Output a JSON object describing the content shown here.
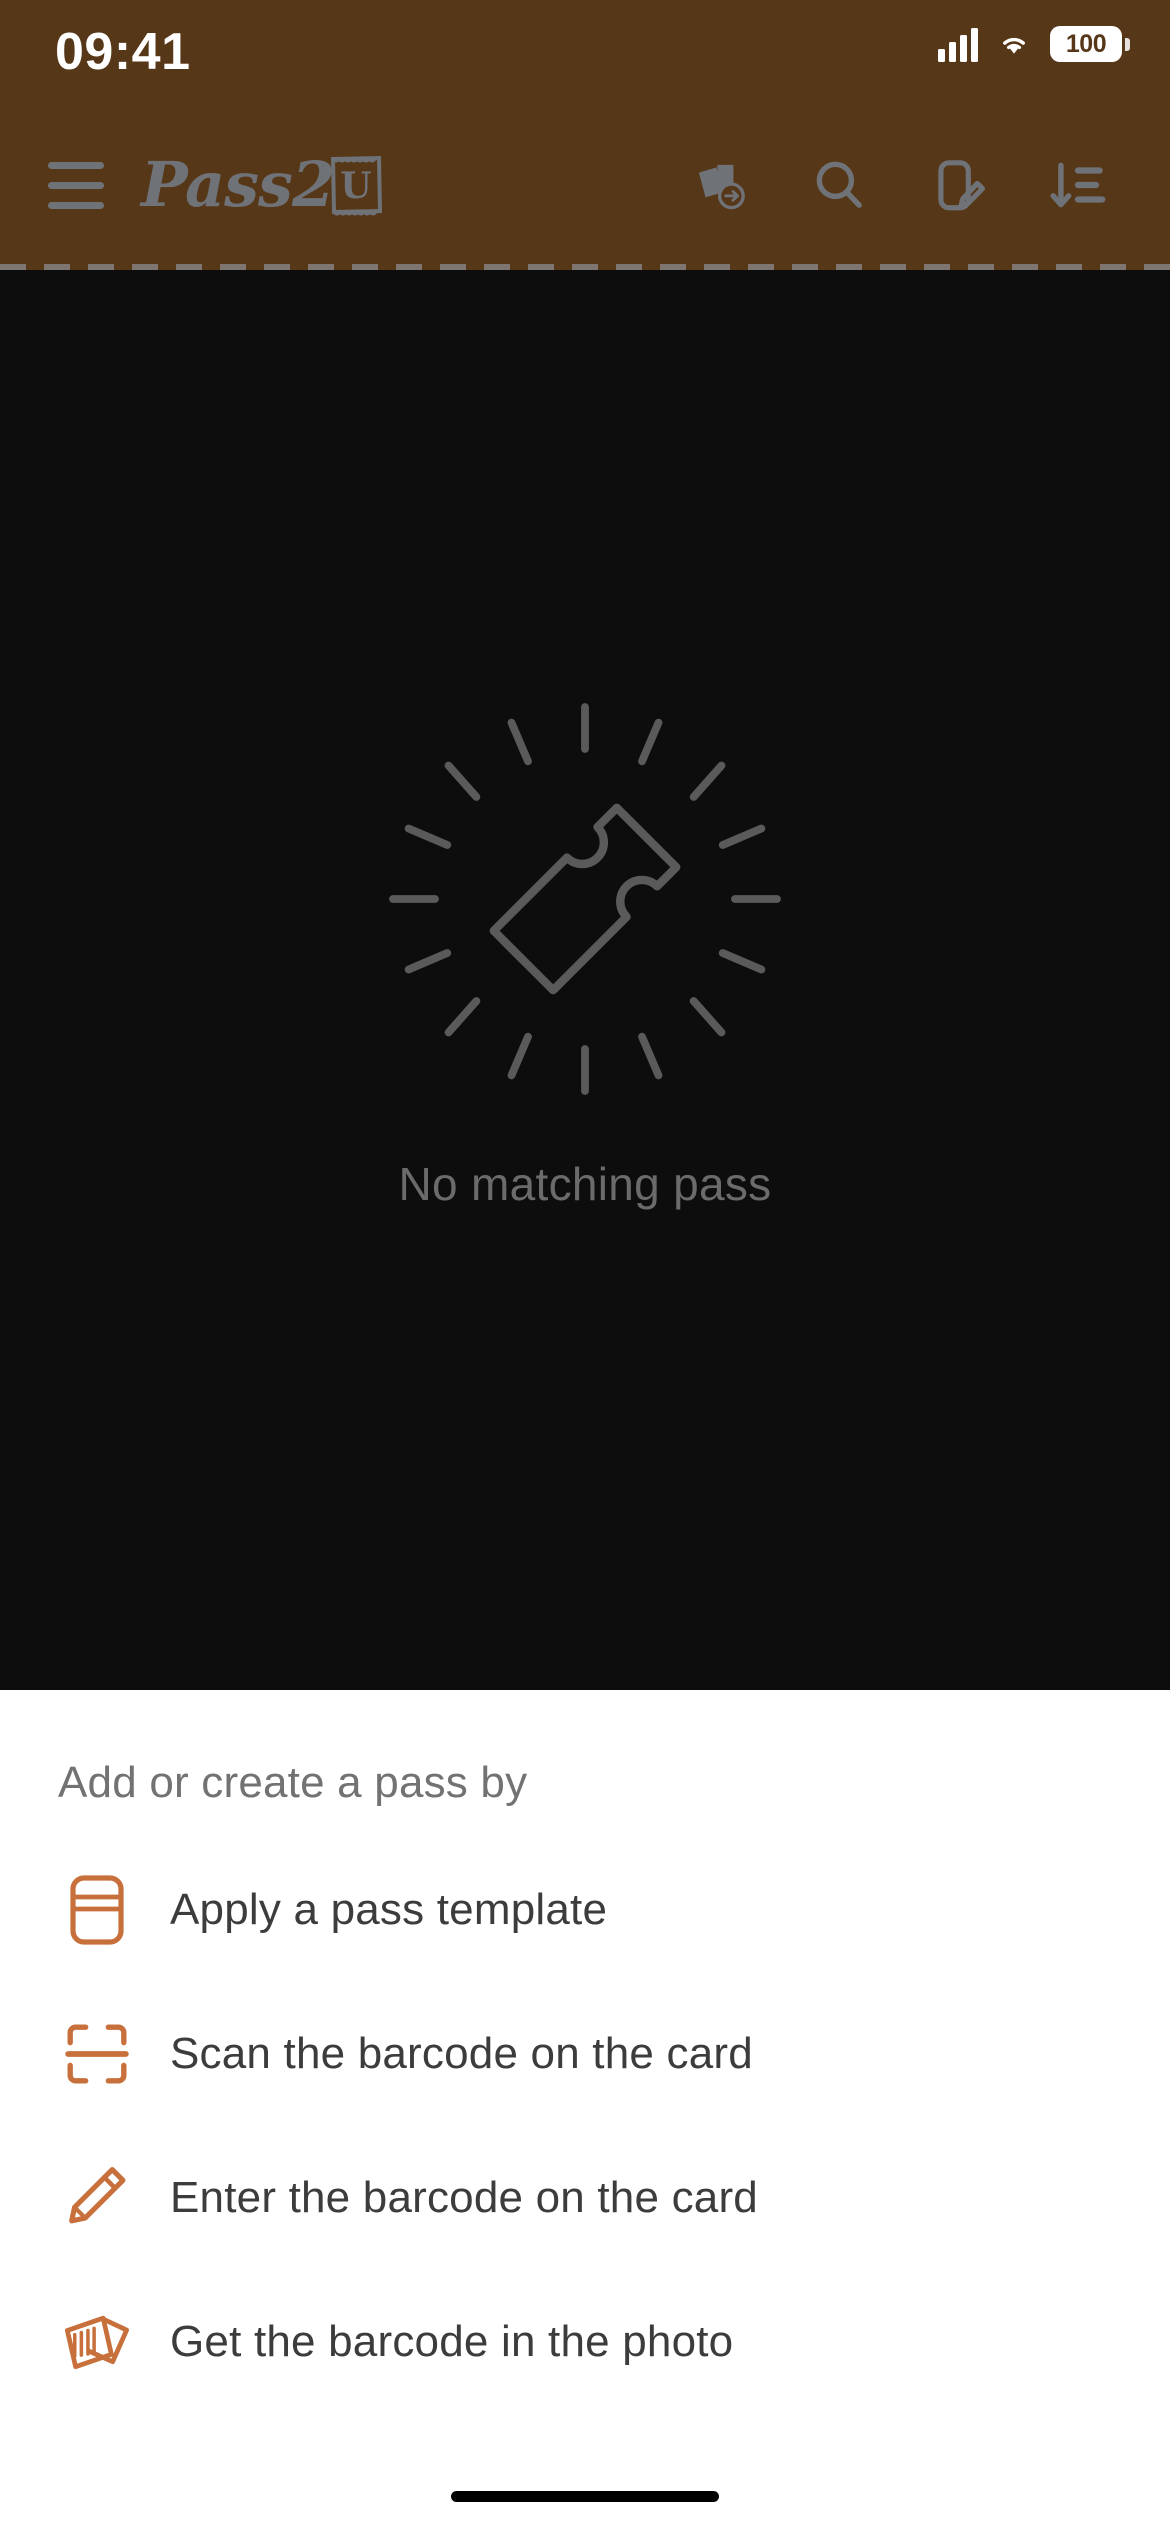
{
  "status_bar": {
    "time": "09:41",
    "battery_level": "100",
    "signal_icon": "cellular-signal-icon",
    "wifi_icon": "wifi-icon",
    "battery_icon": "battery-icon"
  },
  "header": {
    "background_color": "#563718",
    "menu_icon": "hamburger-menu-icon",
    "logo_text": "Pass2",
    "logo_badge_letter": "U",
    "actions": [
      {
        "name": "transfer-passes-icon",
        "label": "Transfer passes"
      },
      {
        "name": "search-icon",
        "label": "Search"
      },
      {
        "name": "create-pass-icon",
        "label": "Create pass"
      },
      {
        "name": "sort-descending-icon",
        "label": "Sort"
      }
    ]
  },
  "empty_state": {
    "icon": "no-pass-ticket-icon",
    "message": "No matching pass"
  },
  "sheet": {
    "title": "Add or create a pass by",
    "accent_color": "#c8703c",
    "options": [
      {
        "icon": "pass-template-icon",
        "label": "Apply a pass template"
      },
      {
        "icon": "barcode-scan-icon",
        "label": "Scan the barcode on the card"
      },
      {
        "icon": "pencil-icon",
        "label": "Enter the barcode on the card"
      },
      {
        "icon": "photo-barcode-icon",
        "label": "Get the barcode in the photo"
      }
    ]
  },
  "home_indicator": "home-indicator"
}
